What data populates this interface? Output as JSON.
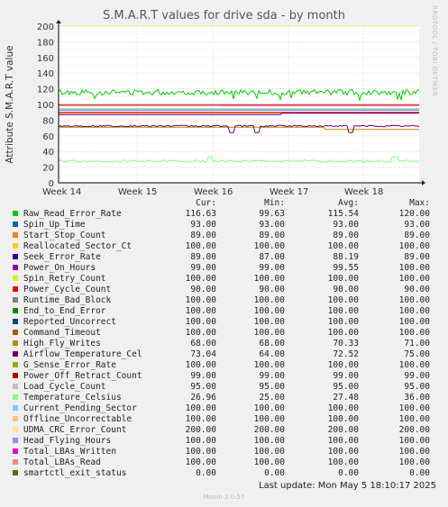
{
  "chart_data": {
    "type": "line",
    "title": "S.M.A.R.T values for drive sda - by month",
    "ylabel": "Attribute S.M.A.R.T value",
    "xlabel": "",
    "side_label": "RRDTOOL / TOBI OETIKER",
    "ylim": [
      0,
      200
    ],
    "yticks": [
      "0",
      "20",
      "40",
      "60",
      "80",
      "100",
      "120",
      "140",
      "160",
      "180",
      "200"
    ],
    "xticks": [
      "Week 14",
      "Week 15",
      "Week 16",
      "Week 17",
      "Week 18"
    ],
    "series": [
      {
        "name": "Raw_Read_Error_Rate",
        "color": "#00cc00",
        "cur": "116.63",
        "min": "99.63",
        "avg": "115.54",
        "max": "120.00"
      },
      {
        "name": "Spin_Up_Time",
        "color": "#0066b3",
        "cur": "93.00",
        "min": "93.00",
        "avg": "93.00",
        "max": "93.00"
      },
      {
        "name": "Start_Stop_Count",
        "color": "#ff8000",
        "cur": "89.00",
        "min": "89.00",
        "avg": "89.00",
        "max": "89.00"
      },
      {
        "name": "Reallocated_Sector_Ct",
        "color": "#ffcc00",
        "cur": "100.00",
        "min": "100.00",
        "avg": "100.00",
        "max": "100.00"
      },
      {
        "name": "Seek_Error_Rate",
        "color": "#330099",
        "cur": "89.00",
        "min": "87.00",
        "avg": "88.19",
        "max": "89.00"
      },
      {
        "name": "Power_On_Hours",
        "color": "#990099",
        "cur": "99.00",
        "min": "99.00",
        "avg": "99.55",
        "max": "100.00"
      },
      {
        "name": "Spin_Retry_Count",
        "color": "#ccff00",
        "cur": "100.00",
        "min": "100.00",
        "avg": "100.00",
        "max": "100.00"
      },
      {
        "name": "Power_Cycle_Count",
        "color": "#ff0000",
        "cur": "90.00",
        "min": "90.00",
        "avg": "90.00",
        "max": "90.00"
      },
      {
        "name": "Runtime_Bad_Block",
        "color": "#808080",
        "cur": "100.00",
        "min": "100.00",
        "avg": "100.00",
        "max": "100.00"
      },
      {
        "name": "End_to_End_Error",
        "color": "#008f00",
        "cur": "100.00",
        "min": "100.00",
        "avg": "100.00",
        "max": "100.00"
      },
      {
        "name": "Reported_Uncorrect",
        "color": "#00487d",
        "cur": "100.00",
        "min": "100.00",
        "avg": "100.00",
        "max": "100.00"
      },
      {
        "name": "Command_Timeout",
        "color": "#b35a00",
        "cur": "100.00",
        "min": "100.00",
        "avg": "100.00",
        "max": "100.00"
      },
      {
        "name": "High_Fly_Writes",
        "color": "#b38f00",
        "cur": "68.00",
        "min": "68.00",
        "avg": "70.33",
        "max": "71.00"
      },
      {
        "name": "Airflow_Temperature_Cel",
        "color": "#6b006b",
        "cur": "73.04",
        "min": "64.00",
        "avg": "72.52",
        "max": "75.00"
      },
      {
        "name": "G_Sense_Error_Rate",
        "color": "#8fb300",
        "cur": "100.00",
        "min": "100.00",
        "avg": "100.00",
        "max": "100.00"
      },
      {
        "name": "Power_Off_Retract_Count",
        "color": "#b30000",
        "cur": "99.00",
        "min": "99.00",
        "avg": "99.00",
        "max": "99.00"
      },
      {
        "name": "Load_Cycle_Count",
        "color": "#bebebe",
        "cur": "95.00",
        "min": "95.00",
        "avg": "95.00",
        "max": "95.00"
      },
      {
        "name": "Temperature_Celsius",
        "color": "#80ff80",
        "cur": "26.96",
        "min": "25.00",
        "avg": "27.48",
        "max": "36.00"
      },
      {
        "name": "Current_Pending_Sector",
        "color": "#80c9ff",
        "cur": "100.00",
        "min": "100.00",
        "avg": "100.00",
        "max": "100.00"
      },
      {
        "name": "Offline_Uncorrectable",
        "color": "#ffc080",
        "cur": "100.00",
        "min": "100.00",
        "avg": "100.00",
        "max": "100.00"
      },
      {
        "name": "UDMA_CRC_Error_Count",
        "color": "#ffe680",
        "cur": "200.00",
        "min": "200.00",
        "avg": "200.00",
        "max": "200.00"
      },
      {
        "name": "Head_Flying_Hours",
        "color": "#aa80ff",
        "cur": "100.00",
        "min": "100.00",
        "avg": "100.00",
        "max": "100.00"
      },
      {
        "name": "Total_LBAs_Written",
        "color": "#ee00cc",
        "cur": "100.00",
        "min": "100.00",
        "avg": "100.00",
        "max": "100.00"
      },
      {
        "name": "Total_LBAs_Read",
        "color": "#ff8080",
        "cur": "100.00",
        "min": "100.00",
        "avg": "100.00",
        "max": "100.00"
      },
      {
        "name": "smartctl_exit_status",
        "color": "#666600",
        "cur": "0.00",
        "min": "0.00",
        "avg": "0.00",
        "max": "0.00"
      }
    ]
  },
  "legend": {
    "cur": "Cur:",
    "min": "Min:",
    "avg": "Avg:",
    "max": "Max:"
  },
  "footer": {
    "last_update": "Last update: Mon May  5 18:10:17 2025",
    "version": "Munin 2.0.57"
  }
}
